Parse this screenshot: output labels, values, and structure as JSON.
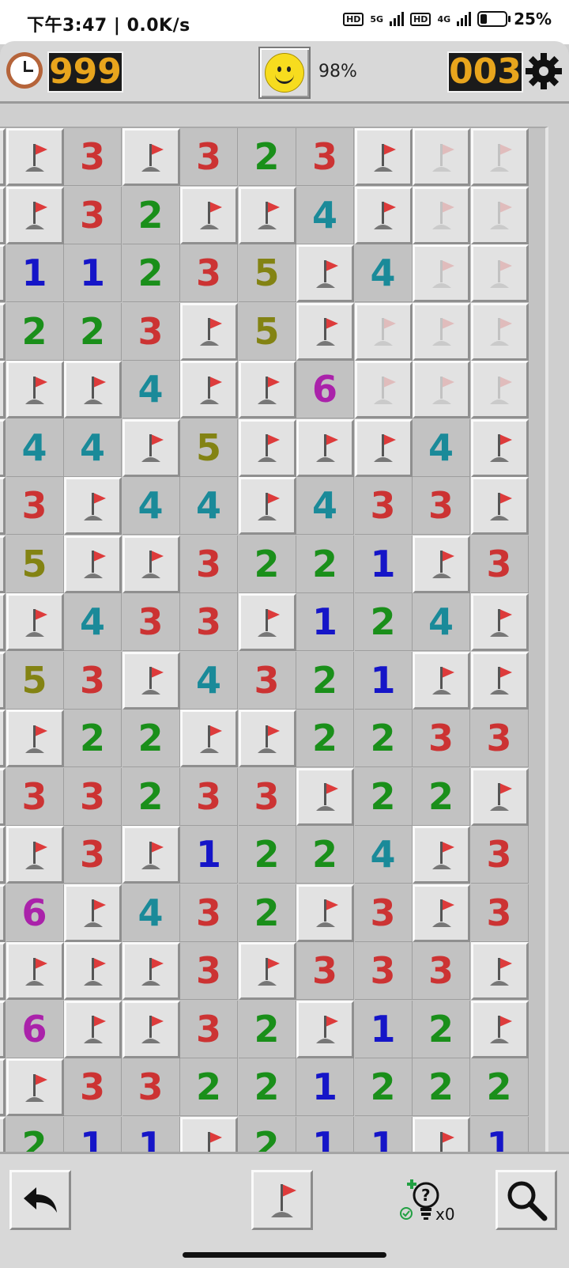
{
  "status_bar": {
    "time_text": "下午3:47 | 0.0K/s",
    "battery_text": "25%",
    "hd_label": "HD",
    "net_5g": "5G",
    "net_4g": "4G"
  },
  "top_bar": {
    "timer": "999",
    "progress": "98%",
    "mine_counter": "003"
  },
  "board": {
    "colors": {
      "1": "#1515c8",
      "2": "#1a8f1a",
      "3": "#cc3333",
      "4": "#1a8a99",
      "5": "#838313",
      "6": "#aa22aa",
      "flag": "#dd3b3b",
      "flag_base": "#777777"
    },
    "rows": [
      [
        "C",
        "F",
        "3",
        "F",
        "3",
        "2",
        "3",
        "F",
        "P",
        "P"
      ],
      [
        "C",
        "F",
        "3",
        "2",
        "F",
        "F",
        "4",
        "F",
        "P",
        "P"
      ],
      [
        "C",
        "1",
        "1",
        "2",
        "3",
        "5",
        "F",
        "4",
        "P",
        "P"
      ],
      [
        "C",
        "2",
        "2",
        "3",
        "F",
        "5",
        "F",
        "P",
        "P",
        "P"
      ],
      [
        "C",
        "F",
        "F",
        "4",
        "F",
        "F",
        "6",
        "P",
        "P",
        "P"
      ],
      [
        "C",
        "4",
        "4",
        "F",
        "5",
        "F",
        "F",
        "F",
        "4",
        "F"
      ],
      [
        "C",
        "3",
        "F",
        "4",
        "4",
        "F",
        "4",
        "3",
        "3",
        "F"
      ],
      [
        "C",
        "5",
        "F",
        "F",
        "3",
        "2",
        "2",
        "1",
        "F",
        "3"
      ],
      [
        "C",
        "F",
        "4",
        "3",
        "3",
        "F",
        "1",
        "2",
        "4",
        "F"
      ],
      [
        "C",
        "5",
        "3",
        "F",
        "4",
        "3",
        "2",
        "1",
        "F",
        "F"
      ],
      [
        "C",
        "F",
        "2",
        "2",
        "F",
        "F",
        "2",
        "2",
        "3",
        "3"
      ],
      [
        "C",
        "3",
        "3",
        "2",
        "3",
        "3",
        "F",
        "2",
        "2",
        "F"
      ],
      [
        "C",
        "F",
        "3",
        "F",
        "1",
        "2",
        "2",
        "4",
        "F",
        "3"
      ],
      [
        "C",
        "6",
        "F",
        "4",
        "3",
        "2",
        "F",
        "3",
        "F",
        "3"
      ],
      [
        "C",
        "F",
        "F",
        "F",
        "3",
        "F",
        "3",
        "3",
        "3",
        "F"
      ],
      [
        "C",
        "6",
        "F",
        "F",
        "3",
        "2",
        "F",
        "1",
        "2",
        "F"
      ],
      [
        "C",
        "F",
        "3",
        "3",
        "2",
        "2",
        "1",
        "2",
        "2",
        "2"
      ],
      [
        "C",
        "2",
        "1",
        "1",
        "F",
        "2",
        "1",
        "1",
        "F",
        "1"
      ]
    ]
  },
  "bottom_bar": {
    "hint_count": "x0"
  }
}
